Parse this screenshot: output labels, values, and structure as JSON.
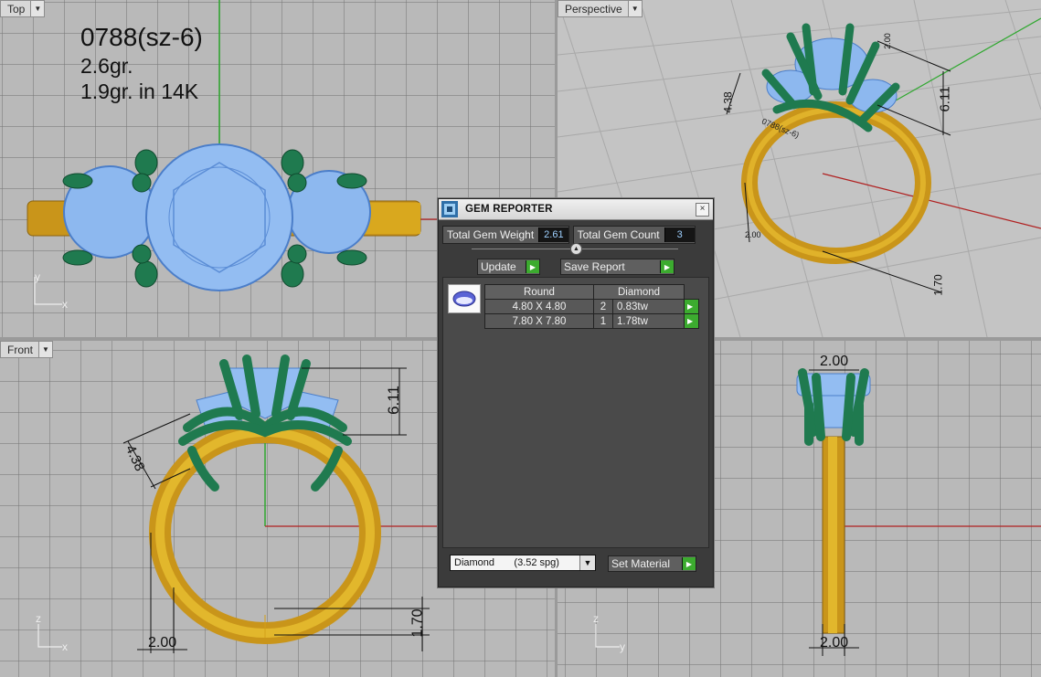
{
  "viewports": {
    "top": {
      "label": "Top",
      "x_axis": "x",
      "y_axis": "y"
    },
    "perspective": {
      "label": "Perspective"
    },
    "front": {
      "label": "Front",
      "x_axis": "x",
      "y_axis": "z"
    },
    "right": {
      "x_axis": "y",
      "y_axis": "z"
    }
  },
  "annotation": {
    "line1": "0788(sz-6)",
    "line2": "2.6gr.",
    "line3": "1.9gr.  in 14K"
  },
  "dimensions": {
    "height": "6.11",
    "prong_width": "4.38",
    "shank_width": "2.00",
    "shank_thickness": "1.70",
    "top_width": "2.00",
    "bottom_width": "2.00",
    "persp_top": "2.00",
    "persp_left": "2.00",
    "persp_bottom": "1.70"
  },
  "gem_reporter": {
    "title": "GEM REPORTER",
    "close": "×",
    "total_weight_label": "Total Gem Weight",
    "total_weight_value": "2.61",
    "total_count_label": "Total Gem Count",
    "total_count_value": "3",
    "update_label": "Update",
    "save_report_label": "Save Report",
    "table": {
      "headers": [
        "Round",
        "Diamond"
      ],
      "rows": [
        {
          "size": "4.80 X 4.80",
          "count": "2",
          "weight": "0.83tw"
        },
        {
          "size": "7.80 X 7.80",
          "count": "1",
          "weight": "1.78tw"
        }
      ]
    },
    "material_select": "Diamond       (3.52 spg)",
    "set_material_label": "Set Material"
  },
  "colors": {
    "gold": "#d4a017",
    "prong": "#1f7a4f",
    "gem": "#8db8ef",
    "panel": "#3b3b3b",
    "go": "#3cab2f"
  }
}
